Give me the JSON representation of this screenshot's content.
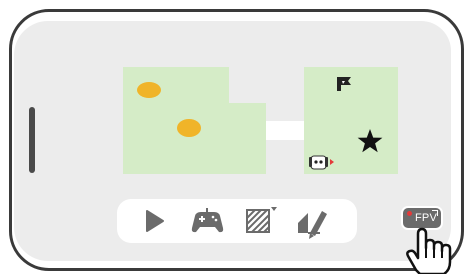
{
  "colors": {
    "frame": "#3a3a3a",
    "screen_bg": "#ececec",
    "map_green": "#d5ecc7",
    "corridor": "#ffffff",
    "coin": "#f0b429",
    "icon_gray": "#6b6b6b",
    "accent_red": "#e43a3a"
  },
  "map": {
    "coins": 2,
    "goal_icon": "star-icon",
    "flag_icon": "flag-icon",
    "robot_icon": "robot-icon"
  },
  "toolbar": {
    "items": [
      {
        "icon": "play-icon"
      },
      {
        "icon": "gamepad-icon"
      },
      {
        "icon": "terrain-icon"
      },
      {
        "icon": "pencil-icon"
      }
    ]
  },
  "fpv": {
    "label": "FPV"
  },
  "pointer": {
    "icon": "hand-pointer-icon"
  }
}
